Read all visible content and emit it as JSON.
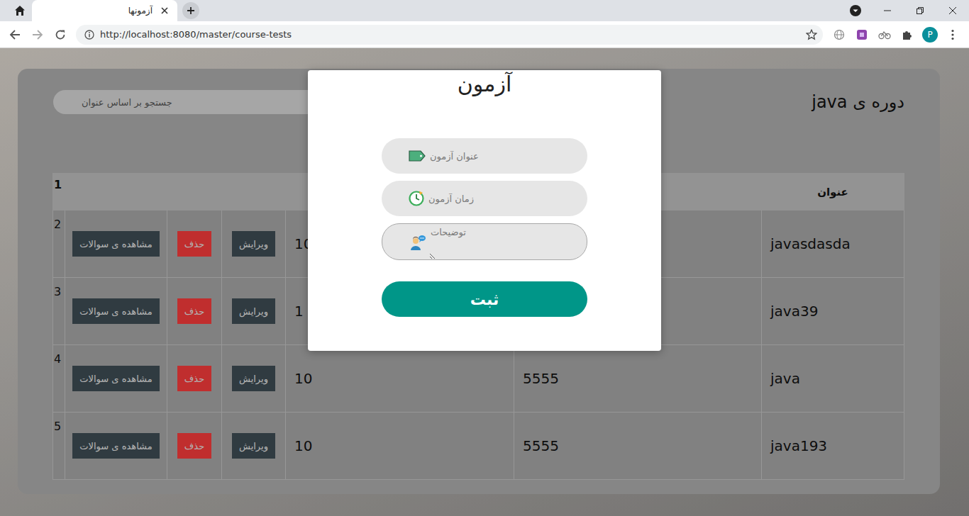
{
  "browser": {
    "tab": {
      "title": "آزمونها",
      "selected": true
    },
    "url": "http://localhost:8080/master/course-tests",
    "profile": "P"
  },
  "page": {
    "heading": "دوره ی java",
    "search": {
      "placeholder": "جستجو بر اساس عنوان"
    }
  },
  "table": {
    "header": {
      "number": "1",
      "title": "عنوان"
    },
    "rows": [
      {
        "number": "2",
        "title": "javasdasda",
        "value": "",
        "count": "10",
        "actions": [
          {
            "label": "ویرایش",
            "kind": "edit"
          },
          {
            "label": "حذف",
            "kind": "delete"
          },
          {
            "label": "مشاهده ی سوالات",
            "kind": "view"
          }
        ]
      },
      {
        "number": "3",
        "title": "java39",
        "value": "",
        "count": "1",
        "actions": [
          {
            "label": "ویرایش",
            "kind": "edit"
          },
          {
            "label": "حذف",
            "kind": "delete"
          },
          {
            "label": "مشاهده ی سوالات",
            "kind": "view"
          }
        ]
      },
      {
        "number": "4",
        "title": "java",
        "value": "5555",
        "count": "10",
        "actions": [
          {
            "label": "ویرایش",
            "kind": "edit"
          },
          {
            "label": "حذف",
            "kind": "delete"
          },
          {
            "label": "مشاهده ی سوالات",
            "kind": "view"
          }
        ]
      },
      {
        "number": "5",
        "title": "java193",
        "value": "5555",
        "count": "10",
        "actions": [
          {
            "label": "ویرایش",
            "kind": "edit"
          },
          {
            "label": "حذف",
            "kind": "delete"
          },
          {
            "label": "مشاهده ی سوالات",
            "kind": "view"
          }
        ]
      }
    ]
  },
  "modal": {
    "title": "آزمون",
    "fields": [
      {
        "placeholder": "عنوان آزمون",
        "kind": "title"
      },
      {
        "placeholder": "زمان آزمون",
        "kind": "time"
      },
      {
        "placeholder": "توضیحات",
        "kind": "description"
      }
    ],
    "submit": "ثبت"
  }
}
